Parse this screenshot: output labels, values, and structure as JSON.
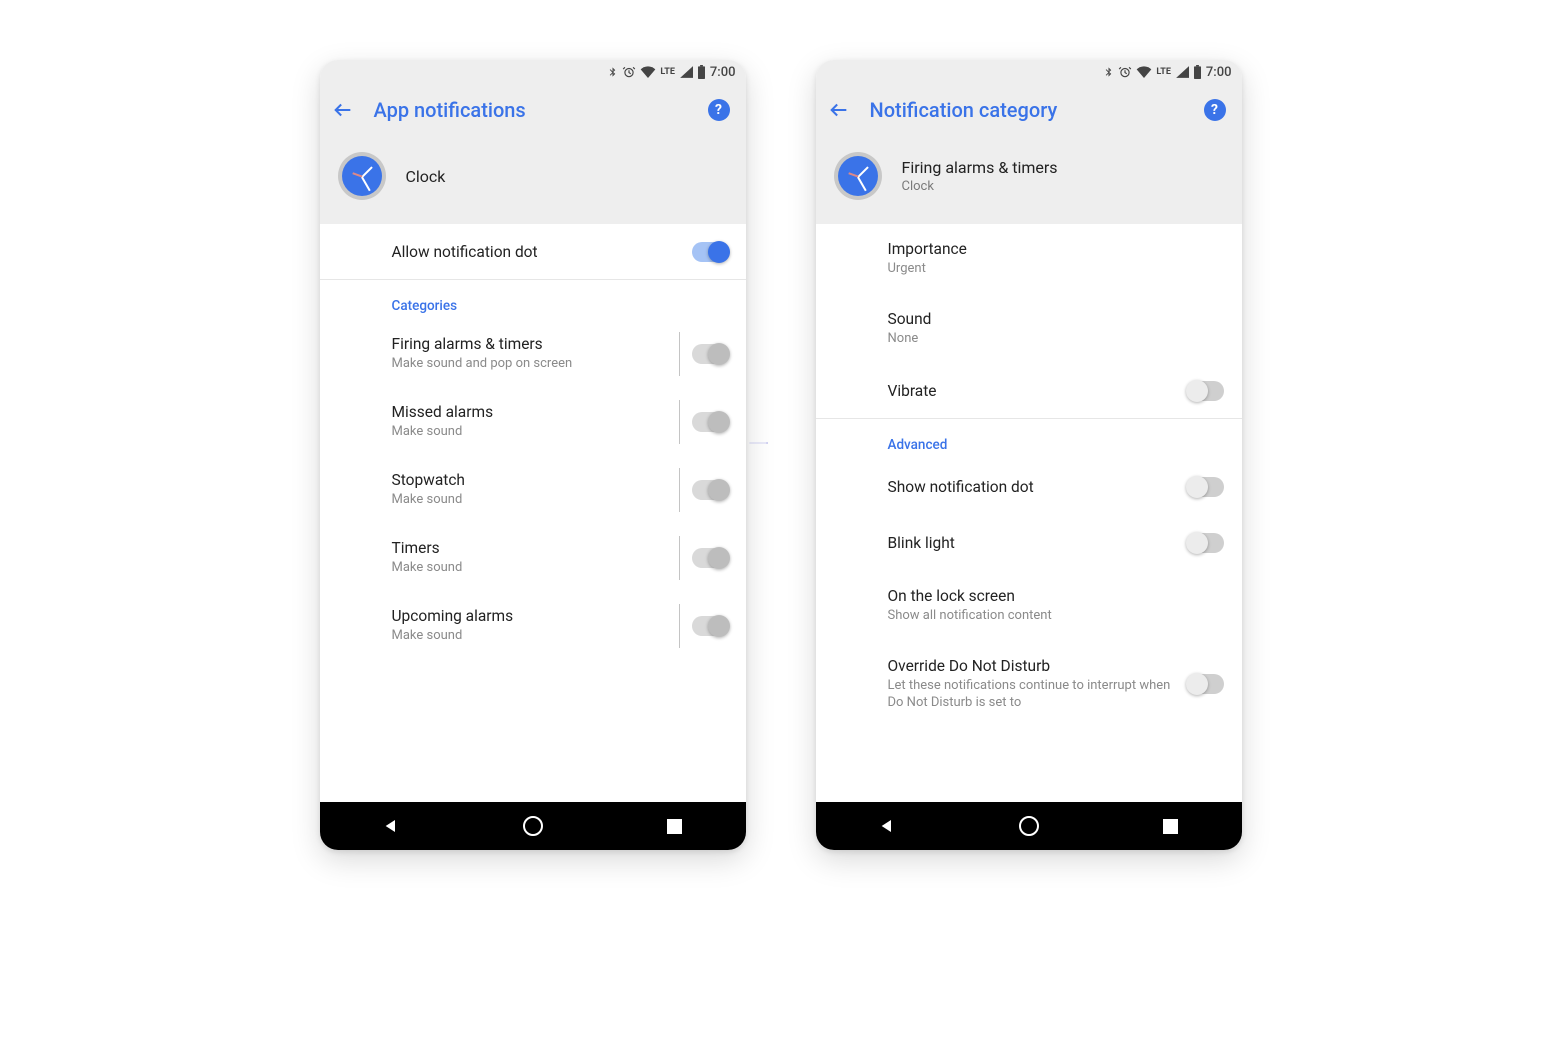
{
  "status": {
    "time": "7:00",
    "lte_label": "LTE"
  },
  "left": {
    "title": "App notifications",
    "app": {
      "name": "Clock"
    },
    "allow_dot": {
      "label": "Allow notification dot",
      "on": true
    },
    "section": "Categories",
    "items": [
      {
        "label": "Firing alarms & timers",
        "sub": "Make sound and pop on screen"
      },
      {
        "label": "Missed alarms",
        "sub": "Make sound"
      },
      {
        "label": "Stopwatch",
        "sub": "Make sound"
      },
      {
        "label": "Timers",
        "sub": "Make sound"
      },
      {
        "label": "Upcoming alarms",
        "sub": "Make sound"
      }
    ]
  },
  "right": {
    "title": "Notification category",
    "app": {
      "name": "Firing alarms & timers",
      "sub": "Clock"
    },
    "importance": {
      "label": "Importance",
      "value": "Urgent"
    },
    "sound": {
      "label": "Sound",
      "value": "None"
    },
    "vibrate": {
      "label": "Vibrate"
    },
    "section": "Advanced",
    "show_dot": {
      "label": "Show notification dot"
    },
    "blink": {
      "label": "Blink light"
    },
    "lockscreen": {
      "label": "On the lock screen",
      "value": "Show all notification content"
    },
    "dnd": {
      "label": "Override Do Not Disturb",
      "value": "Let these notifications continue to interrupt when Do Not Disturb is set to"
    }
  },
  "colors": {
    "accent": "#3a73e8"
  }
}
